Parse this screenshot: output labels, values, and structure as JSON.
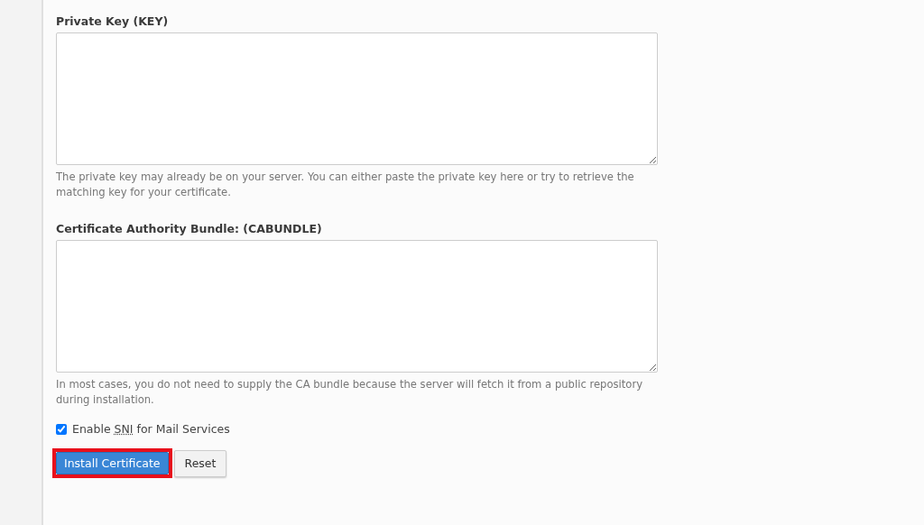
{
  "fields": [
    {
      "label": "Private Key (KEY)",
      "help": "The private key may already be on your server. You can either paste the private key here or try to retrieve the matching key for your certificate."
    },
    {
      "label": "Certificate Authority Bundle: (CABUNDLE)",
      "help": "In most cases, you do not need to supply the CA bundle because the server will fetch it from a public repository during installation."
    }
  ],
  "sni_option": {
    "checked": true,
    "text_before": "Enable ",
    "abbreviation": "SNI",
    "text_after": " for Mail Services"
  },
  "buttons": [
    {
      "label": "Install Certificate",
      "kind": "primary",
      "highlighted": true
    },
    {
      "label": "Reset",
      "kind": "secondary",
      "highlighted": false
    }
  ]
}
